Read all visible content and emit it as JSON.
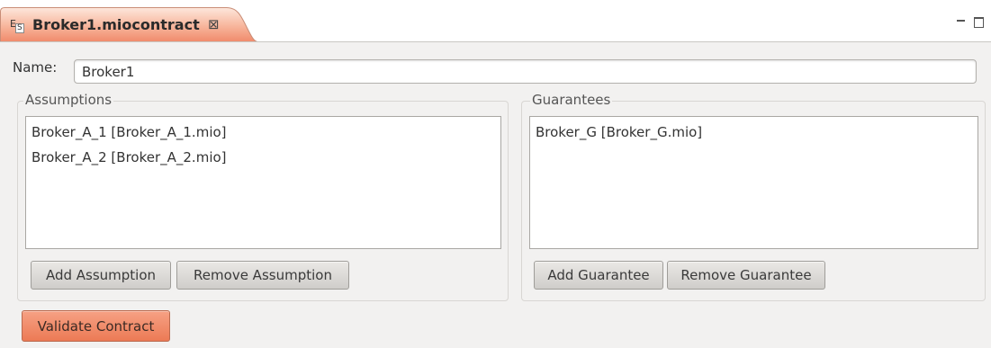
{
  "tab": {
    "title": "Broker1.miocontract",
    "close_glyph": "⊠",
    "icon": "contract-file-icon"
  },
  "window_controls": {
    "minimize": "minimize-icon",
    "maximize": "maximize-icon"
  },
  "form": {
    "name_label": "Name:",
    "name_value": "Broker1"
  },
  "assumptions": {
    "title": "Assumptions",
    "items": [
      "Broker_A_1 [Broker_A_1.mio]",
      "Broker_A_2 [Broker_A_2.mio]"
    ],
    "add_label": "Add Assumption",
    "remove_label": "Remove Assumption"
  },
  "guarantees": {
    "title": "Guarantees",
    "items": [
      "Broker_G [Broker_G.mio]"
    ],
    "add_label": "Add Guarantee",
    "remove_label": "Remove Guarantee"
  },
  "validate_label": "Validate Contract",
  "colors": {
    "tab_accent": "#f0896a",
    "validate_button": "#ec7a55",
    "form_background": "#f2f1f0"
  }
}
